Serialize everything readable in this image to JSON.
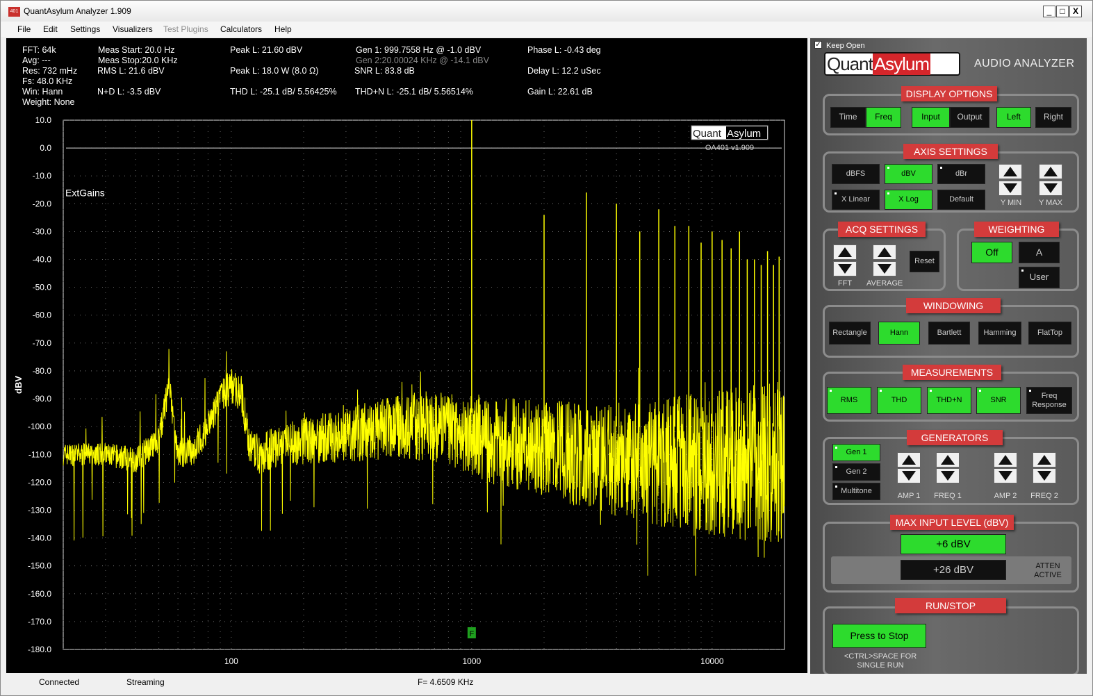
{
  "window": {
    "title": "QuantAsylum Analyzer 1.909",
    "icon_text": "401",
    "min_glyph": "_",
    "max_glyph": "□",
    "close_glyph": "X"
  },
  "menu": [
    "File",
    "Edit",
    "Settings",
    "Visualizers",
    "Test Plugins",
    "Calculators",
    "Help"
  ],
  "measurements": {
    "fft": "FFT: 64k",
    "avg": "Avg: ---",
    "res": "Res: 732 mHz",
    "fs": "Fs: 48.0 KHz",
    "win": "Win: Hann",
    "weight": "Weight: None",
    "meas_start": "Meas Start: 20.0 Hz",
    "meas_stop": "Meas Stop:20.0 KHz",
    "rms": "RMS L: 21.6 dBV",
    "nd": "N+D L: -3.5 dBV",
    "peak_dbv": "Peak L: 21.60 dBV",
    "peak_w": "Peak L: 18.0 W (8.0 Ω)",
    "thd": "THD L: -25.1 dB/ 5.56425%",
    "gen1": "Gen 1: 999.7558 Hz @ -1.0  dBV",
    "gen2": "Gen 2:20.00024 KHz @ -14.1  dBV",
    "snr": "SNR L: 83.8 dB",
    "thdn": "THD+N L: -25.1 dB/ 5.56514%",
    "phase": "Phase L: -0.43 deg",
    "delay": "Delay L: 12.2 uSec",
    "gain": "Gain L: 22.61 dB"
  },
  "plot": {
    "ylabel": "dBV",
    "annotation": "ExtGains",
    "logo_left": "Quant",
    "logo_right": "Asylum",
    "version": "OA401 v1.909",
    "marker_label": "F",
    "trace_color": "#ffff00",
    "y_ticks": [
      "10.0",
      "0.0",
      "-10.0",
      "-20.0",
      "-30.0",
      "-40.0",
      "-50.0",
      "-60.0",
      "-70.0",
      "-80.0",
      "-90.0",
      "-100.0",
      "-110.0",
      "-120.0",
      "-130.0",
      "-140.0",
      "-150.0",
      "-160.0",
      "-170.0",
      "-180.0"
    ],
    "x_ticks": [
      "100",
      "1000",
      "10000"
    ]
  },
  "chart_data": {
    "type": "line",
    "title": "",
    "xlabel": "",
    "ylabel": "dBV",
    "x_scale": "log",
    "xlim": [
      20,
      20000
    ],
    "ylim": [
      -180,
      10
    ],
    "grid": true,
    "reference_line_y": 0,
    "series": [
      {
        "x": [
          20,
          30,
          40,
          50,
          55,
          60,
          70,
          80,
          90,
          100,
          110,
          120,
          130,
          150,
          200,
          300,
          500,
          700,
          900,
          1000,
          1100,
          1500,
          2000,
          3000,
          5000,
          7000,
          10000,
          15000,
          20000
        ],
        "y": [
          -110,
          -110,
          -112,
          -105,
          -85,
          -110,
          -108,
          -100,
          -90,
          -85,
          -88,
          -108,
          -110,
          -108,
          -105,
          -103,
          -100,
          -100,
          -102,
          21.6,
          -105,
          -106,
          -108,
          -110,
          -112,
          -113,
          -113,
          -113,
          -113
        ]
      }
    ],
    "harmonics": {
      "x": [
        2000,
        3000,
        4000,
        5000,
        6000,
        7000,
        8000,
        9000,
        10000,
        11000,
        12000,
        13000,
        14000,
        15000,
        16000,
        17000,
        18000,
        19000
      ],
      "y": [
        -24,
        -16,
        -20,
        -30,
        -22,
        -28,
        -28,
        -34,
        -30,
        -33,
        -36,
        -30,
        -40,
        -40,
        -42,
        -37,
        -42,
        -39
      ]
    }
  },
  "side": {
    "keep_open": "Keep Open",
    "logo_quant": "Quant",
    "logo_asylum": "Asylum",
    "audio_analyzer": "AUDIO ANALYZER",
    "display_options": {
      "title": "DISPLAY OPTIONS",
      "time": "Time",
      "freq": "Freq",
      "input": "Input",
      "output": "Output",
      "left": "Left",
      "right": "Right"
    },
    "axis": {
      "title": "AXIS SETTINGS",
      "dbfs": "dBFS",
      "dbv": "dBV",
      "dbr": "dBr",
      "xlinear": "X Linear",
      "xlog": "X Log",
      "default": "Default",
      "ymin": "Y MIN",
      "ymax": "Y MAX"
    },
    "acq": {
      "title": "ACQ SETTINGS",
      "fft": "FFT",
      "average": "AVERAGE",
      "reset": "Reset"
    },
    "weighting": {
      "title": "WEIGHTING",
      "off": "Off",
      "a": "A",
      "user": "User"
    },
    "windowing": {
      "title": "WINDOWING",
      "rect": "Rectangle",
      "hann": "Hann",
      "bartlett": "Bartlett",
      "hamming": "Hamming",
      "flattop": "FlatTop"
    },
    "measurements": {
      "title": "MEASUREMENTS",
      "rms": "RMS",
      "thd": "THD",
      "thdn": "THD+N",
      "snr": "SNR",
      "freq_resp": "Freq Response"
    },
    "generators": {
      "title": "GENERATORS",
      "gen1": "Gen 1",
      "gen2": "Gen 2",
      "multitone": "Multitone",
      "amp1": "AMP 1",
      "freq1": "FREQ 1",
      "amp2": "AMP 2",
      "freq2": "FREQ 2"
    },
    "max_input": {
      "title": "MAX INPUT LEVEL (dBV)",
      "plus6": "+6 dBV",
      "plus26": "+26 dBV",
      "atten": "ATTEN ACTIVE"
    },
    "runstop": {
      "title": "RUN/STOP",
      "button": "Press to Stop",
      "hint": "<CTRL>SPACE FOR SINGLE RUN"
    }
  },
  "status": {
    "connected": "Connected",
    "streaming": "Streaming",
    "freq": "F= 4.6509 KHz"
  }
}
